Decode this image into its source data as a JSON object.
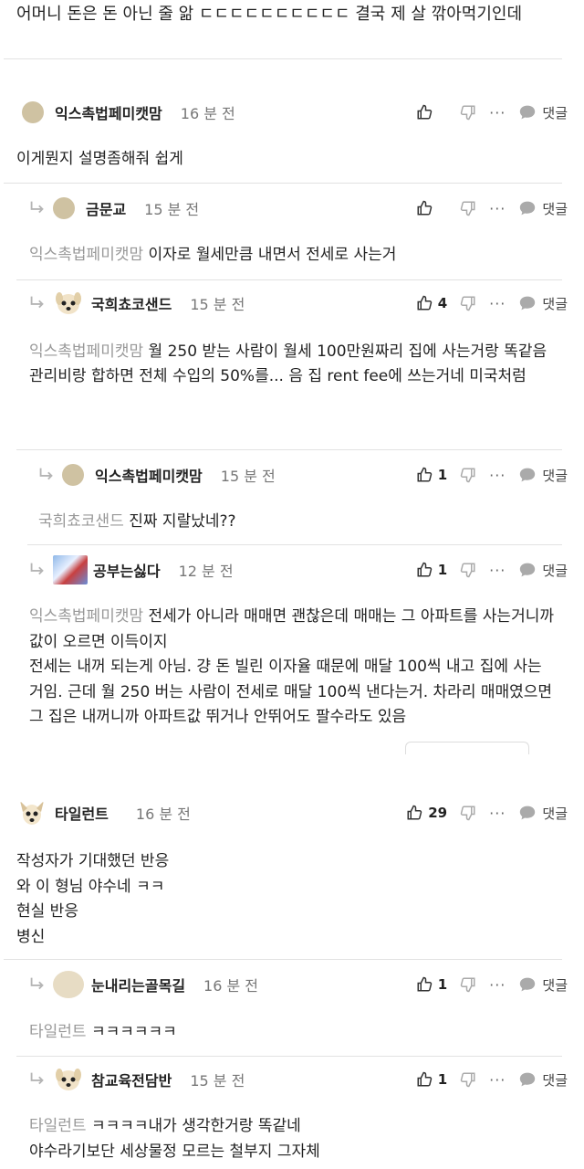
{
  "top_comment": "어머니 돈은 돈 아닌 줄 앎 ㄷㄷㄷㄷㄷㄷㄷㄷㄷㄷ 결국 제 살 깎아먹기인데",
  "reply_label": "댓글",
  "more_label": "···",
  "comments": [
    {
      "author": "익스촉법페미캣맘",
      "time": "16 분 전",
      "likes": "",
      "mention": "",
      "text": "이게뭔지 설명좀해줘 쉽게"
    },
    {
      "author": "금문교",
      "time": "15 분 전",
      "likes": "",
      "mention": "익스촉법페미캣맘",
      "text": "이자로 월세만큼 내면서 전세로 사는거"
    },
    {
      "author": "국희쵸코샌드",
      "time": "15 분 전",
      "likes": "4",
      "mention": "익스촉법페미캣맘",
      "text": "월 250 받는 사람이 월세 100만원짜리 집에 사는거랑 똑같음\n관리비랑 합하면 전체 수입의 50%를... 음 집 rent fee에 쓰는거네 미국처럼"
    },
    {
      "author": "익스촉법페미캣맘",
      "time": "15 분 전",
      "likes": "1",
      "mention": "국희쵸코샌드",
      "text": "진짜 지랄났네??"
    },
    {
      "author": "공부는싫다",
      "time": "12 분 전",
      "likes": "1",
      "mention": "익스촉법페미캣맘",
      "text": "전세가 아니라 매매면 괜찮은데 매매는 그 아파트를 사는거니까 값이 오르면 이득이지\n전세는 내꺼 되는게 아님. 걍 돈 빌린 이자율 때문에 매달 100씩 내고 집에 사는거임. 근데 월 250 버는 사람이 전세로 매달 100씩 낸다는거. 차라리 매매였으면 그 집은 내꺼니까 아파트값 뛰거나 안뛰어도 팔수라도 있음"
    },
    {
      "author": "타일런트",
      "time": "16 분 전",
      "likes": "29",
      "mention": "",
      "text": "작성자가 기대했던 반응\n와 이 형님 야수네 ㅋㅋ\n현실 반응\n병신"
    },
    {
      "author": "눈내리는골목길",
      "time": "16 분 전",
      "likes": "1",
      "mention": "타일런트",
      "text": "ㅋㅋㅋㅋㅋㅋ"
    },
    {
      "author": "참교육전담반",
      "time": "15 분 전",
      "likes": "1",
      "mention": "타일런트",
      "text": "ㅋㅋㅋㅋ내가 생각한거랑 똑같네\n야수라기보단 세상물정 모르는 철부지 그자체"
    }
  ]
}
